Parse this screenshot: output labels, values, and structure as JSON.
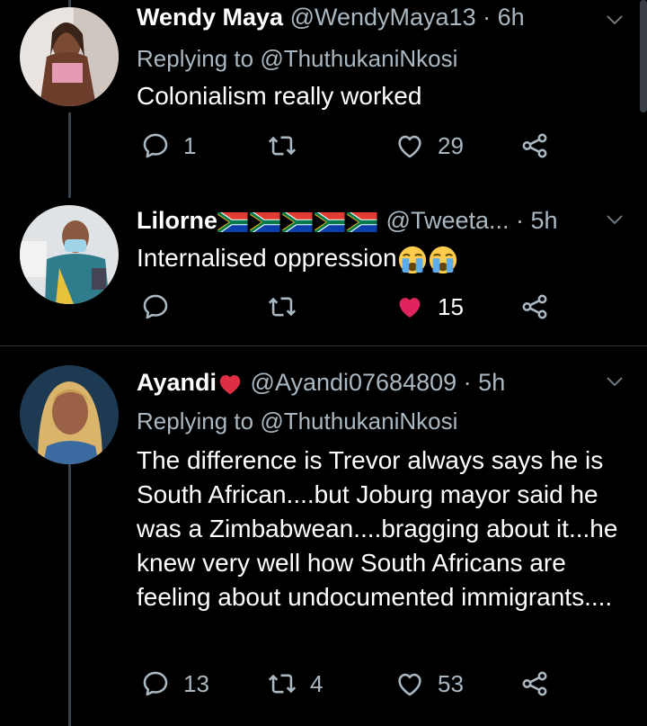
{
  "tweets": [
    {
      "name": "Wendy Maya",
      "handle": "@WendyMaya13",
      "dot": "·",
      "time": "6h",
      "replying_prefix": "Replying to",
      "replying_to": "@ThuthukaniNkosi",
      "text": "Colonialism really worked",
      "replies": "1",
      "retweets": "",
      "likes": "29",
      "liked": false
    },
    {
      "name": "Lilorne",
      "handle": "@Tweeta...",
      "dot": "·",
      "time": "5h",
      "text": "Internalised oppression",
      "replies": "",
      "retweets": "",
      "likes": "15",
      "liked": true
    },
    {
      "name": "Ayandi",
      "handle": "@Ayandi07684809",
      "dot": "·",
      "time": "5h",
      "replying_prefix": "Replying to",
      "replying_to": "@ThuthukaniNkosi",
      "text": "The difference is Trevor always says he is South African....but Joburg mayor said he was a Zimbabwean....bragging about it...he knew very well how South Africans are feeling about undocumented immigrants....",
      "replies": "13",
      "retweets": "4",
      "likes": "53",
      "liked": false
    }
  ],
  "colors": {
    "background": "#000000",
    "muted": "#aab8c2",
    "like_active": "#e0245e"
  },
  "icons": [
    "reply-icon",
    "retweet-icon",
    "like-icon",
    "share-icon",
    "chevron-down-icon",
    "south-africa-flag-icon",
    "crying-face-icon",
    "red-heart-icon"
  ]
}
